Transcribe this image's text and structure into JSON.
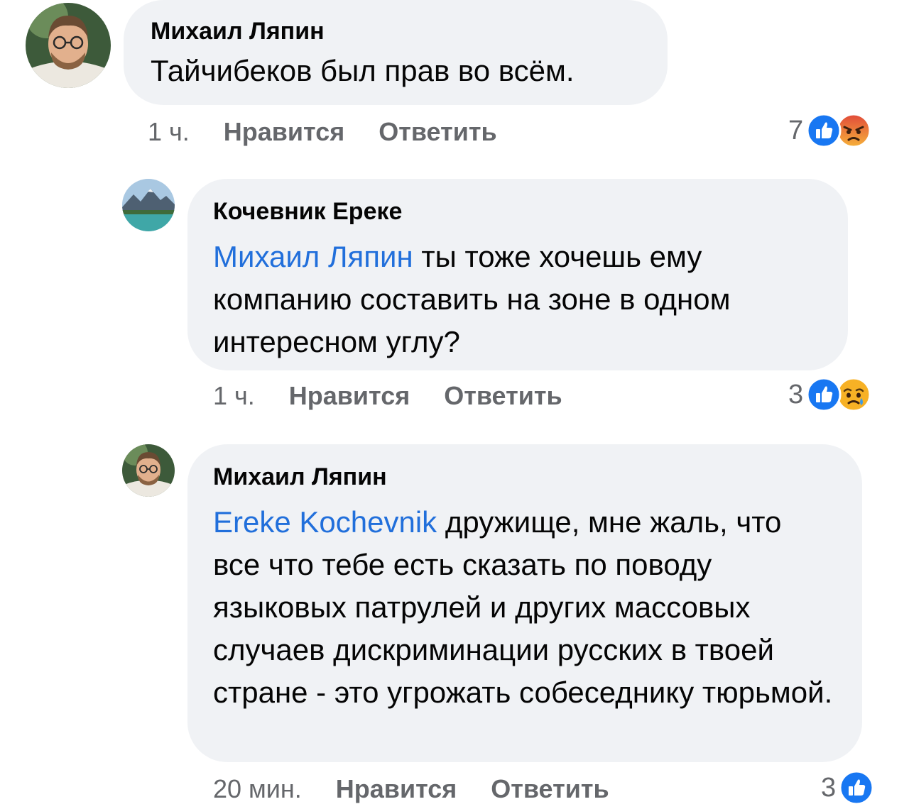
{
  "comments": [
    {
      "author": "Михаил Ляпин",
      "mention": "",
      "text": "Тайчибеков был прав во всём.",
      "time": "1 ч.",
      "like_label": "Нравится",
      "reply_label": "Ответить",
      "reaction_count": "7",
      "reactions": [
        "like-icon",
        "angry-icon"
      ]
    },
    {
      "author": "Кочевник Ереке",
      "mention": "Михаил Ляпин",
      "text": "ты тоже хочешь ему компанию составить на зоне в одном интересном углу?",
      "time": "1 ч.",
      "like_label": "Нравится",
      "reply_label": "Ответить",
      "reaction_count": "3",
      "reactions": [
        "like-icon",
        "sad-icon"
      ]
    },
    {
      "author": "Михаил Ляпин",
      "mention": "Ereke Kochevnik",
      "text": "дружище, мне жаль, что все что тебе есть сказать по поводу языковых патрулей и других массовых случаев дискриминации русских в твоей стране - это угрожать собеседнику тюрьмой.",
      "time": "20 мин.",
      "like_label": "Нравится",
      "reply_label": "Ответить",
      "reaction_count": "3",
      "reactions": [
        "like-icon"
      ]
    }
  ],
  "colors": {
    "bubble": "#f0f2f5",
    "mention": "#216fdb",
    "meta": "#65676b",
    "like": "#1877f2",
    "angry": "#e9710f",
    "sad": "#f7b125"
  }
}
